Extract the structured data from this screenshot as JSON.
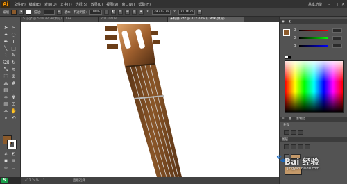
{
  "app": {
    "logo": "Ai"
  },
  "menubar": {
    "items": [
      "文件(F)",
      "编辑(E)",
      "对象(O)",
      "文字(T)",
      "选择(S)",
      "效果(C)",
      "视图(V)",
      "窗口(W)",
      "帮助(H)"
    ],
    "workspace": "基本功能"
  },
  "controlbar": {
    "selection_label": "编组",
    "stroke_label": "描边:",
    "style_label": "基本",
    "opacity_label": "不透明度:",
    "opacity_value": "100%",
    "x_value": "79.407 m",
    "y_value": "21.16 m",
    "fill_color": "#8b5a2b"
  },
  "tabs": [
    {
      "label": "5.jpg* @ 50% (RGB/预览)",
      "active": false
    },
    {
      "label": "t3+...",
      "active": false
    },
    {
      "label": "20170603...",
      "active": false
    },
    {
      "label": "未标题-74* @ 412.24% (CMYK/预览)",
      "active": true
    }
  ],
  "toolbox": {
    "icons": [
      "selection-tool",
      "direct-selection-tool",
      "magic-wand-tool",
      "lasso-tool",
      "pen-tool",
      "type-tool",
      "line-tool",
      "rectangle-tool",
      "paintbrush-tool",
      "pencil-tool",
      "eraser-tool",
      "rotate-tool",
      "scale-tool",
      "width-tool",
      "free-transform-tool",
      "shape-builder-tool",
      "perspective-tool",
      "mesh-tool",
      "gradient-tool",
      "eyedropper-tool",
      "blend-tool",
      "symbol-sprayer-tool",
      "graph-tool",
      "artboard-tool",
      "slice-tool",
      "hand-tool",
      "zoom-tool"
    ],
    "fill_color": "#8b5a2b",
    "stroke_color": "#ffffff"
  },
  "color_panel": {
    "sliders": [
      {
        "label": "R",
        "gradient": "linear-gradient(to right,#000,#ff0000)"
      },
      {
        "label": "G",
        "gradient": "linear-gradient(to right,#000,#00ff00)"
      },
      {
        "label": "B",
        "gradient": "linear-gradient(to right,#000,#0000ff)"
      }
    ]
  },
  "panels": {
    "appearance_label": "外观",
    "layers_label": "图层",
    "transparency_label": "透明度"
  },
  "statusbar": {
    "zoom": "412.24%",
    "artboard": "1",
    "tool": "直接选择"
  },
  "watermark": {
    "text": "Bai 经验",
    "url": "jingyan.baidu.com"
  }
}
